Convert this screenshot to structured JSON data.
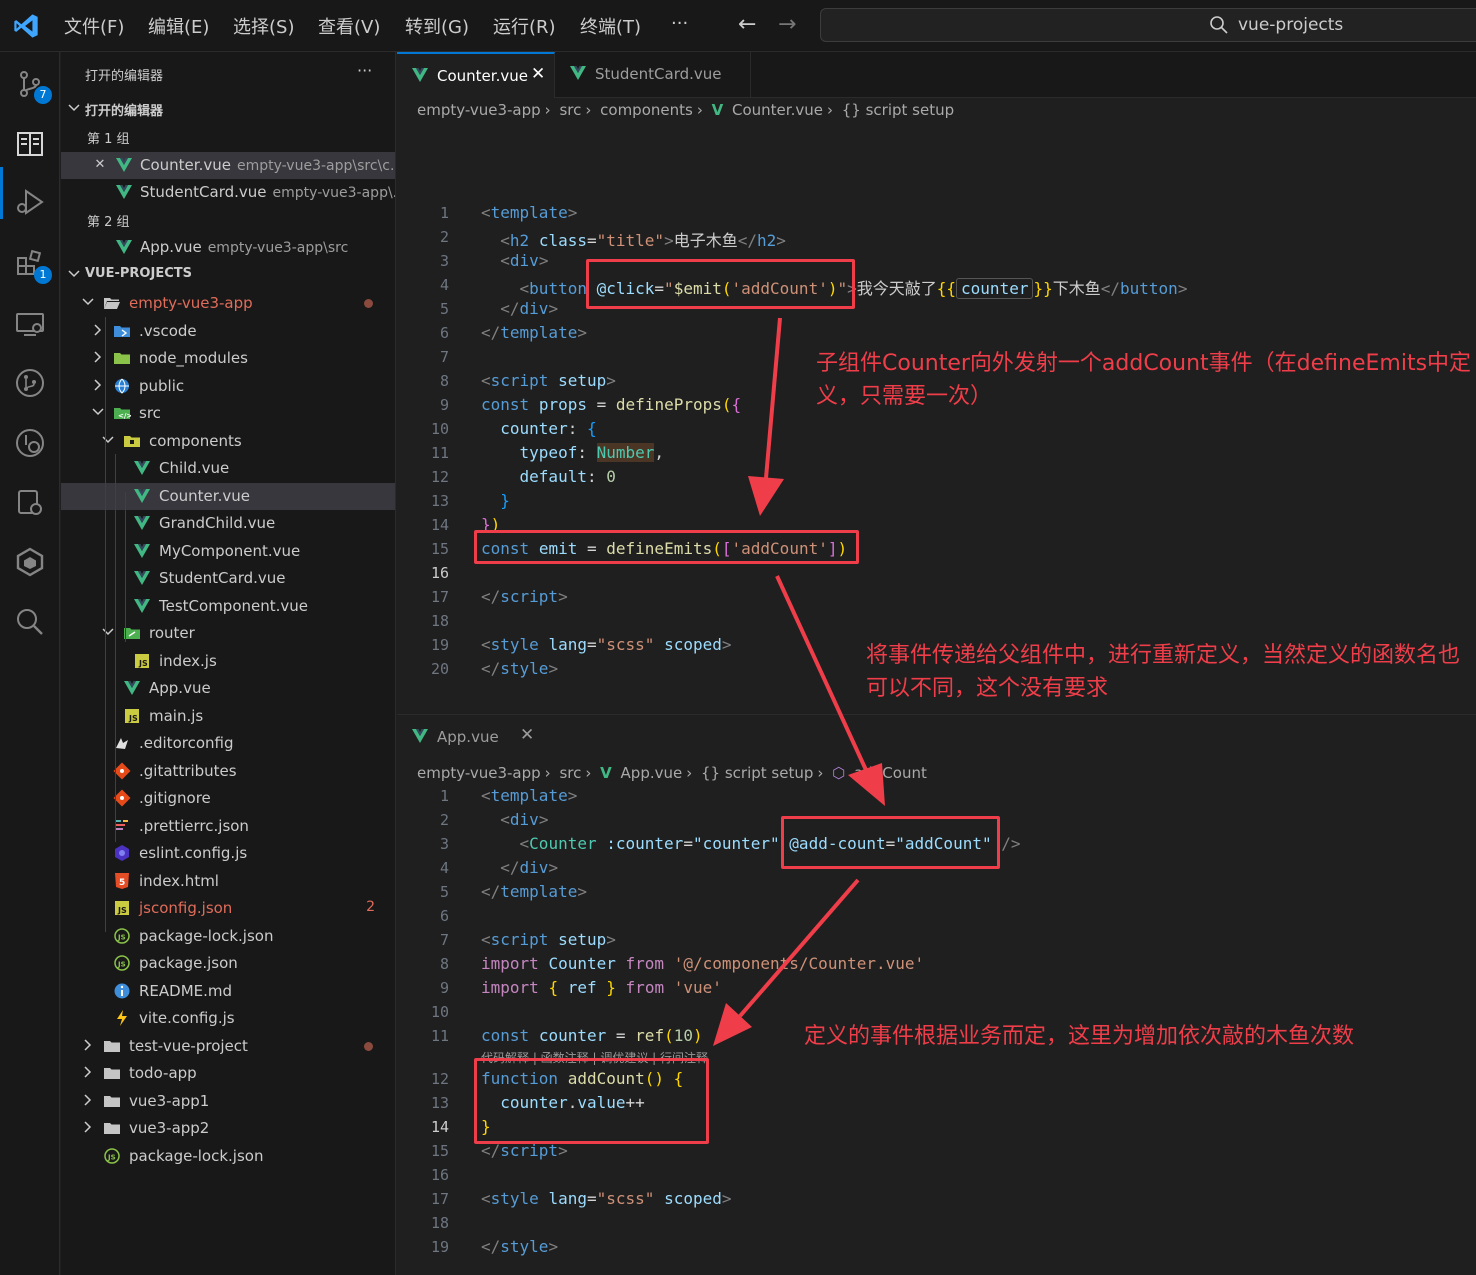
{
  "menu": {
    "items": [
      "文件(F)",
      "编辑(E)",
      "选择(S)",
      "查看(V)",
      "转到(G)",
      "运行(R)",
      "终端(T)",
      "···"
    ],
    "search_text": "vue-projects"
  },
  "activity": {
    "scm_badge": "7",
    "ext_badge": "1"
  },
  "sidebar": {
    "title": "打开的编辑器",
    "more": "···",
    "open_editors_header": "打开的编辑器",
    "group1": "第 1 组",
    "group2": "第 2 组",
    "open_items": [
      {
        "name": "Counter.vue",
        "desc": "empty-vue3-app\\src\\c..."
      },
      {
        "name": "StudentCard.vue",
        "desc": "empty-vue3-app\\..."
      },
      {
        "name": "App.vue",
        "desc": "empty-vue3-app\\src"
      }
    ],
    "project_header": "VUE-PROJECTS",
    "tree": [
      {
        "label": "empty-vue3-app"
      },
      {
        "label": ".vscode"
      },
      {
        "label": "node_modules"
      },
      {
        "label": "public"
      },
      {
        "label": "src"
      },
      {
        "label": "components"
      },
      {
        "label": "Child.vue"
      },
      {
        "label": "Counter.vue"
      },
      {
        "label": "GrandChild.vue"
      },
      {
        "label": "MyComponent.vue"
      },
      {
        "label": "StudentCard.vue"
      },
      {
        "label": "TestComponent.vue"
      },
      {
        "label": "router"
      },
      {
        "label": "index.js"
      },
      {
        "label": "App.vue"
      },
      {
        "label": "main.js"
      },
      {
        "label": ".editorconfig"
      },
      {
        "label": ".gitattributes"
      },
      {
        "label": ".gitignore"
      },
      {
        "label": ".prettierrc.json"
      },
      {
        "label": "eslint.config.js"
      },
      {
        "label": "index.html"
      },
      {
        "label": "jsconfig.json",
        "problems": "2"
      },
      {
        "label": "package-lock.json"
      },
      {
        "label": "package.json"
      },
      {
        "label": "README.md"
      },
      {
        "label": "vite.config.js"
      },
      {
        "label": "test-vue-project"
      },
      {
        "label": "todo-app"
      },
      {
        "label": "vue3-app1"
      },
      {
        "label": "vue3-app2"
      },
      {
        "label": "package-lock.json"
      }
    ]
  },
  "editor_top": {
    "tabs": [
      "Counter.vue",
      "StudentCard.vue"
    ],
    "close": "✕",
    "breadcrumb": [
      "empty-vue3-app",
      "src",
      "components",
      "Counter.vue",
      "{} script setup"
    ],
    "line_numbers": [
      "1",
      "2",
      "3",
      "4",
      "5",
      "6",
      "7",
      "8",
      "9",
      "10",
      "11",
      "12",
      "13",
      "14",
      "15",
      "16",
      "17",
      "18",
      "19",
      "20"
    ],
    "code": {
      "l1": "template",
      "l2_tag": "h2",
      "l2_attr": "class",
      "l2_val": "\"title\"",
      "l2_text": "电子木鱼",
      "l2_close": "h2",
      "l3": "div",
      "l4_tag": "button",
      "l4_attr": "@click",
      "l4_val_a": "\"",
      "l4_val_fn": "$emit",
      "l4_val_b": "'addCount'",
      "l4_val_c": "\"",
      "l4_text_a": "我今天敲了",
      "l4_mus_open": "{{",
      "l4_counter": "counter",
      "l4_mus_close": "}}",
      "l4_text_b": "下木鱼",
      "l5": "div",
      "l6": "template",
      "l8_tag": "script",
      "l8_attr": "setup",
      "l9_kw": "const",
      "l9_var": "props",
      "l9_fn": "defineProps",
      "l10_key": "counter",
      "l11_key": "typeof",
      "l11_val": "Number",
      "l12_key": "default",
      "l12_val": "0",
      "l15_kw": "const",
      "l15_var": "emit",
      "l15_fn": "defineEmits",
      "l15_str": "'addCount'",
      "l17_tag": "script",
      "l19_tag": "style",
      "l19_attr": "lang",
      "l19_val": "\"scss\"",
      "l19_attr2": "scoped",
      "l20_tag": "style"
    }
  },
  "editor_bottom": {
    "tab": "App.vue",
    "close": "✕",
    "breadcrumb": [
      "empty-vue3-app",
      "src",
      "App.vue",
      "{} script setup",
      "addCount"
    ],
    "line_numbers": [
      "1",
      "2",
      "3",
      "4",
      "5",
      "6",
      "7",
      "8",
      "9",
      "10",
      "11",
      "12",
      "13",
      "14",
      "15",
      "16",
      "17",
      "18",
      "19"
    ],
    "codelens": "代码解释 | 函数注释 | 调优建议 | 行间注释",
    "code": {
      "l1": "template",
      "l2": "div",
      "l3_comp": "Counter",
      "l3_attr": ":counter",
      "l3_val": "\"counter\"",
      "l3_attr2": "@add-count",
      "l3_val2": "\"addCount\"",
      "l4": "div",
      "l5": "template",
      "l7_tag": "script",
      "l7_attr": "setup",
      "l8_kw": "import",
      "l8_name": "Counter",
      "l8_from": "from",
      "l8_path": "'@/components/Counter.vue'",
      "l9_kw": "import",
      "l9_name": "ref",
      "l9_from": "from",
      "l9_path": "'vue'",
      "l11_kw": "const",
      "l11_var": "counter",
      "l11_fn": "ref",
      "l11_num": "10",
      "l12_kw": "function",
      "l12_fn": "addCount",
      "l13_var": "counter",
      "l13_prop": "value",
      "l15_tag": "script",
      "l17_tag": "style",
      "l17_attr": "lang",
      "l17_val": "\"scss\"",
      "l17_attr2": "scoped",
      "l19_tag": "style"
    }
  },
  "annotations": {
    "a1": "子组件Counter向外发射一个addCount事件（在defineEmits中定义，只需要一次）",
    "a2": "将事件传递给父组件中，进行重新定义，当然定义的函数名也可以不同，这个没有要求",
    "a3": "定义的事件根据业务而定，这里为增加依次敲的木鱼次数"
  },
  "colors": {
    "accent": "#0078d4",
    "annotation": "#ef3e4a",
    "vue": "#41b883"
  }
}
